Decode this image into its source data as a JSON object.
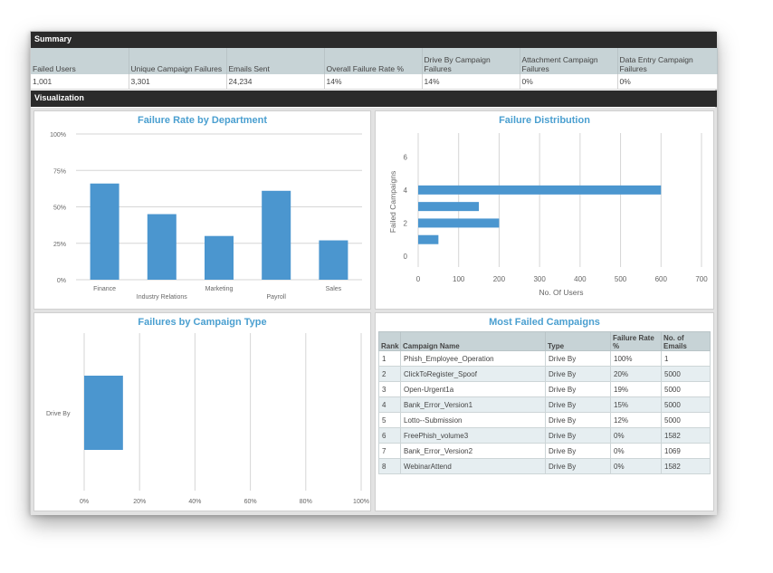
{
  "summary": {
    "header": "Summary",
    "columns": [
      "Failed Users",
      "Unique Campaign Failures",
      "Emails Sent",
      "Overall Failure Rate %",
      "Drive By Campaign Failures",
      "Attachment Campaign Failures",
      "Data Entry Campaign Failures"
    ],
    "values": [
      "1,001",
      "3,301",
      "24,234",
      "14%",
      "14%",
      "0%",
      "0%"
    ]
  },
  "visualization": {
    "header": "Visualization"
  },
  "chart_data": [
    {
      "type": "bar",
      "title": "Failure Rate by Department",
      "categories": [
        "Finance",
        "Industry Relations",
        "Marketing",
        "Payroll",
        "Sales"
      ],
      "values": [
        66,
        45,
        30,
        61,
        27
      ],
      "ylim": [
        0,
        100
      ],
      "yticks": [
        "0%",
        "25%",
        "50%",
        "75%",
        "100%"
      ],
      "grid": true
    },
    {
      "type": "bar",
      "orientation": "horizontal",
      "title": "Failure Distribution",
      "xlabel": "No. Of Users",
      "ylabel": "Failed Campaigns",
      "points": [
        {
          "campaigns": 4,
          "users": 600
        },
        {
          "campaigns": 3,
          "users": 150
        },
        {
          "campaigns": 2,
          "users": 200
        },
        {
          "campaigns": 1,
          "users": 50
        }
      ],
      "xlim": [
        0,
        700
      ],
      "xticks": [
        0,
        100,
        200,
        300,
        400,
        500,
        600,
        700
      ],
      "ylim": [
        0,
        7
      ],
      "yticks": [
        0,
        2,
        4,
        6
      ],
      "grid": true
    },
    {
      "type": "bar",
      "orientation": "horizontal",
      "title": "Failures by Campaign Type",
      "categories": [
        "Drive By"
      ],
      "values": [
        14
      ],
      "xlim": [
        0,
        100
      ],
      "xticks": [
        "0%",
        "20%",
        "40%",
        "60%",
        "80%",
        "100%"
      ],
      "grid": true
    }
  ],
  "most_failed": {
    "title": "Most Failed Campaigns",
    "columns": [
      "Rank",
      "Campaign Name",
      "Type",
      "Failure Rate %",
      "No. of Emails"
    ],
    "rows": [
      [
        "1",
        "Phish_Employee_Operation",
        "Drive By",
        "100%",
        "1"
      ],
      [
        "2",
        "ClickToRegister_Spoof",
        "Drive By",
        "20%",
        "5000"
      ],
      [
        "3",
        "Open-Urgent1a",
        "Drive By",
        "19%",
        "5000"
      ],
      [
        "4",
        "Bank_Error_Version1",
        "Drive By",
        "15%",
        "5000"
      ],
      [
        "5",
        "Lotto--Submission",
        "Drive By",
        "12%",
        "5000"
      ],
      [
        "6",
        "FreePhish_volume3",
        "Drive By",
        "0%",
        "1582"
      ],
      [
        "7",
        "Bank_Error_Version2",
        "Drive By",
        "0%",
        "1069"
      ],
      [
        "8",
        "WebinarAttend",
        "Drive By",
        "0%",
        "1582"
      ]
    ]
  },
  "colors": {
    "bar": "#4b96cf",
    "title": "#4a9fd0",
    "header_bg": "#2b2b2b",
    "table_header": "#c7d3d6"
  }
}
